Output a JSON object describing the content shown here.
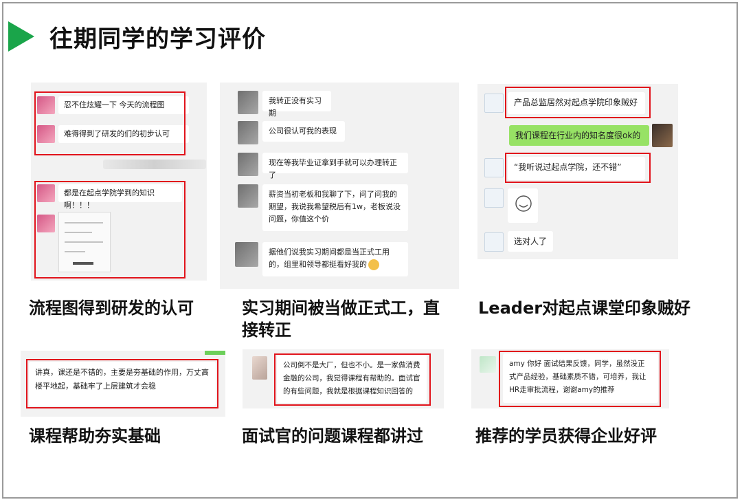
{
  "title": "往期同学的学习评价",
  "cards": [
    {
      "messages": [
        "忍不住炫耀一下 今天的流程图",
        "难得得到了研发的们的初步认可",
        "都是在起点学院学到的知识啊！！！"
      ],
      "caption": "流程图得到研发的认可"
    },
    {
      "messages": [
        "我转正没有实习期",
        "公司很认可我的表现",
        "现在等我毕业证拿到手就可以办理转正了",
        "薪资当初老板和我聊了下，问了问我的期望，我说我希望税后有1w，老板说没问题，你值这个价",
        "据他们说我实习期间都是当正式工用的，组里和领导都挺看好我的"
      ],
      "caption": "实习期间被当做正式工，直接转正"
    },
    {
      "messages": [
        "产品总监居然对起点学院印象贼好",
        "我们课程在行业内的知名度很ok的",
        "“我听说过起点学院，还不错”",
        "选对人了"
      ],
      "caption": "Leader对起点课堂印象贼好"
    },
    {
      "messages": [
        "讲真，课还是不错的，主要是夯基础的作用，万丈高楼平地起，基础牢了上层建筑才会稳"
      ],
      "caption": "课程帮助夯实基础"
    },
    {
      "messages": [
        "公司倒不是大厂，但也不小。是一家做消费金融的公司，我觉得课程有帮助的。面试官的有些问题，我就是根据课程知识回答的"
      ],
      "caption": "面试官的问题课程都讲过"
    },
    {
      "messages": [
        "amy 你好 面试结果反馈，同学，虽然没正式产品经验，基础素质不错，可培养，我让HR走审批流程，谢谢amy的推荐"
      ],
      "caption": "推荐的学员获得企业好评"
    }
  ],
  "colors": {
    "accent_green": "#1aa54a",
    "highlight_red": "#e1131b",
    "chat_green": "#97e265"
  }
}
